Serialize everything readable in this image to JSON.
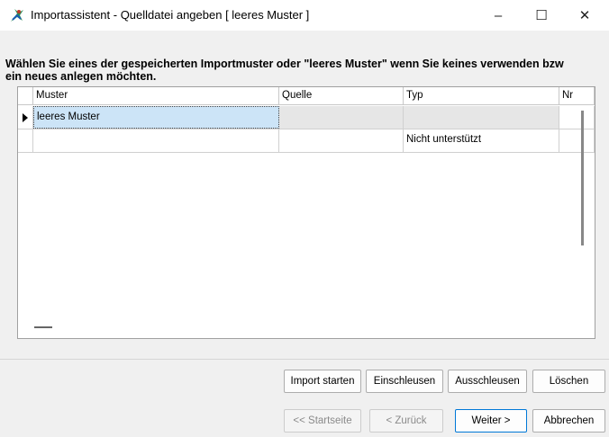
{
  "window": {
    "title": "Importassistent - Quelldatei angeben [ leeres Muster ]",
    "minimize": "–",
    "maximize": "☐",
    "close": "✕",
    "icon": "app-icon"
  },
  "instruction": {
    "line1": "Wählen Sie eines der gespeicherten Importmuster oder \"leeres Muster\" wenn Sie keines verwenden bzw",
    "line2": "ein neues anlegen möchten."
  },
  "grid": {
    "columns": [
      "Muster",
      "Quelle",
      "Typ",
      "Nr"
    ],
    "rows": [
      {
        "muster": "leeres Muster",
        "quelle": "",
        "typ": "",
        "nr": "",
        "selected": true
      },
      {
        "muster": "",
        "quelle": "",
        "typ": "Nicht unterstützt",
        "nr": "",
        "selected": false
      }
    ]
  },
  "buttons": {
    "import_start": "Import starten",
    "einschleusen": "Einschleusen",
    "ausschleusen": "Ausschleusen",
    "loeschen": "Löschen",
    "startseite": "<< Startseite",
    "zurueck": "< Zurück",
    "weiter": "Weiter >",
    "abbrechen": "Abbrechen"
  },
  "colors": {
    "selection": "#cce4f7",
    "primary_border": "#0078d7"
  }
}
